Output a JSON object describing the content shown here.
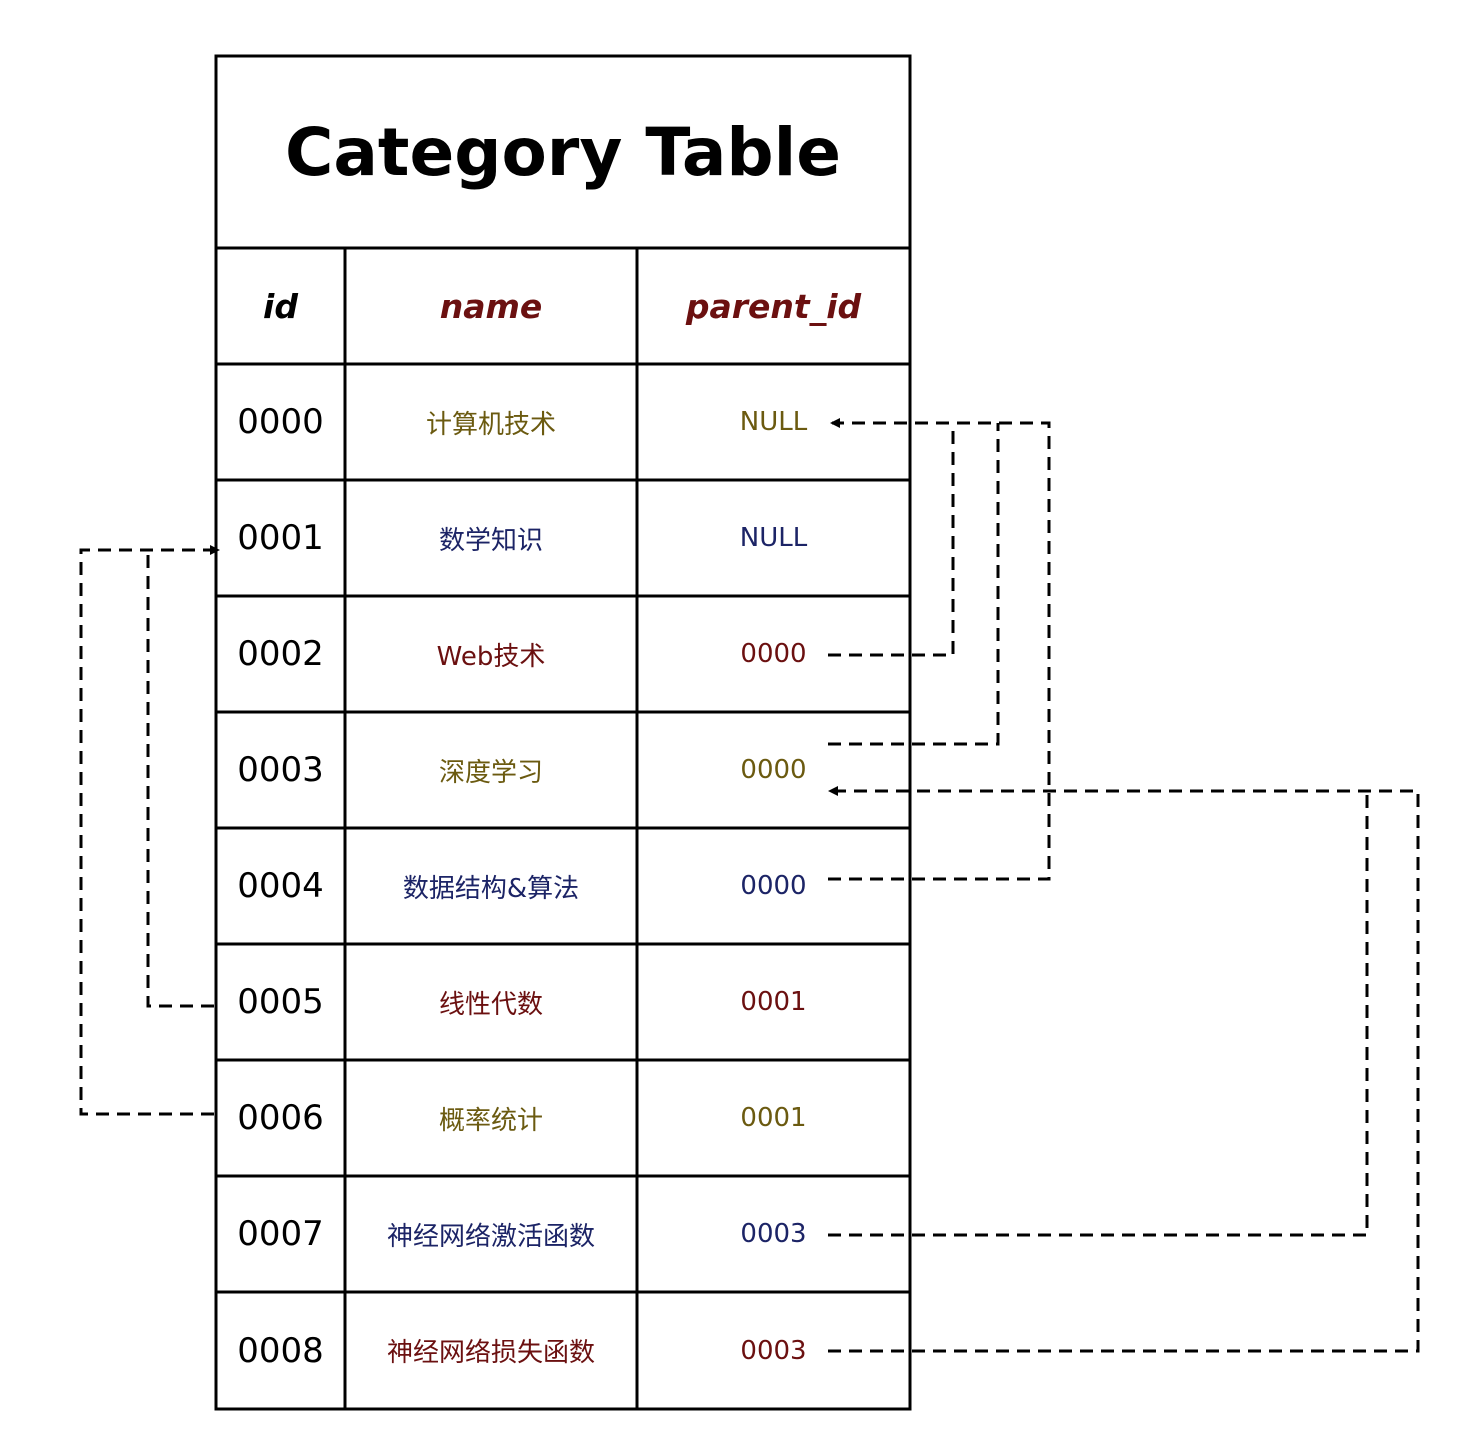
{
  "title": "Category Table",
  "columns": {
    "id": {
      "label": "id",
      "color": "#000000"
    },
    "name": {
      "label": "name",
      "color": "#6b1010"
    },
    "parent_id": {
      "label": "parent_id",
      "color": "#6b1010"
    }
  },
  "rows": [
    {
      "id": "0000",
      "name": "计算机技术",
      "parent_id": "NULL",
      "color": "#6b5a10"
    },
    {
      "id": "0001",
      "name": "数学知识",
      "parent_id": "NULL",
      "color": "#1c2466"
    },
    {
      "id": "0002",
      "name": "Web技术",
      "parent_id": "0000",
      "color": "#6b1010"
    },
    {
      "id": "0003",
      "name": "深度学习",
      "parent_id": "0000",
      "color": "#6b5a10"
    },
    {
      "id": "0004",
      "name": "数据结构&算法",
      "parent_id": "0000",
      "color": "#1c2466"
    },
    {
      "id": "0005",
      "name": "线性代数",
      "parent_id": "0001",
      "color": "#6b1010"
    },
    {
      "id": "0006",
      "name": "概率统计",
      "parent_id": "0001",
      "color": "#6b5a10"
    },
    {
      "id": "0007",
      "name": "神经网络激活函数",
      "parent_id": "0003",
      "color": "#1c2466"
    },
    {
      "id": "0008",
      "name": "神经网络损失函数",
      "parent_id": "0003",
      "color": "#6b1010"
    }
  ]
}
